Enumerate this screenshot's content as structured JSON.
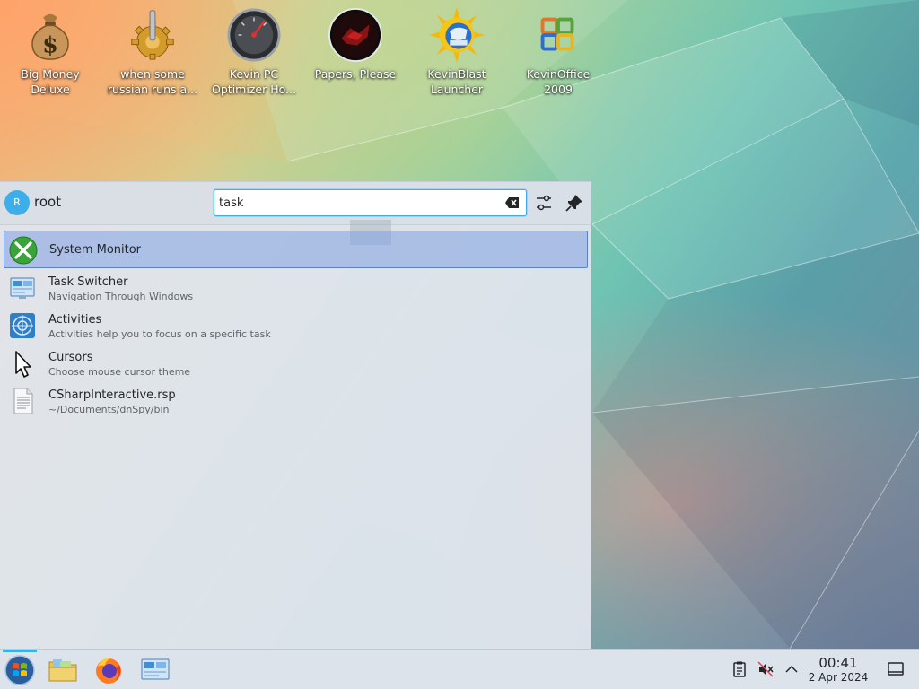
{
  "desktop": {
    "icons": [
      {
        "label": "Big Money Deluxe",
        "icon": "money-bag-icon"
      },
      {
        "label": "when some russian runs a...",
        "icon": "gear-joystick-icon"
      },
      {
        "label": "Kevin PC Optimizer Ho...",
        "icon": "speedometer-icon"
      },
      {
        "label": "Papers, Please",
        "icon": "papers-please-icon"
      },
      {
        "label": "KevinBlast Launcher",
        "icon": "sun-globe-icon"
      },
      {
        "label": "KevinOffice 2009",
        "icon": "office-logo-icon"
      }
    ]
  },
  "launcher": {
    "user": {
      "initial": "R",
      "name": "root"
    },
    "search": {
      "value": "task ",
      "placeholder": ""
    },
    "results": [
      {
        "title": "System Monitor",
        "subtitle": "",
        "icon": "system-monitor-icon",
        "selected": true
      },
      {
        "title": "Task Switcher",
        "subtitle": "Navigation Through Windows",
        "icon": "task-switcher-icon"
      },
      {
        "title": "Activities",
        "subtitle": "Activities help you to focus on a specific task",
        "icon": "activities-icon"
      },
      {
        "title": "Cursors",
        "subtitle": "Choose mouse cursor theme",
        "icon": "cursor-icon"
      },
      {
        "title": "CSharpInteractive.rsp",
        "subtitle": "~/Documents/dnSpy/bin",
        "icon": "text-file-icon"
      }
    ]
  },
  "taskbar": {
    "apps": [
      "start-menu-icon",
      "file-manager-icon",
      "firefox-icon",
      "task-switcher-icon"
    ],
    "tray": [
      "clipboard-icon",
      "volume-muted-icon",
      "chevron-up-icon",
      "show-desktop-icon"
    ],
    "clock": {
      "time": "00:41",
      "date": "2 Apr 2024"
    }
  },
  "colors": {
    "accent": "#3daee9",
    "selection": "#8aa4e0",
    "panel": "#dde3ea"
  }
}
